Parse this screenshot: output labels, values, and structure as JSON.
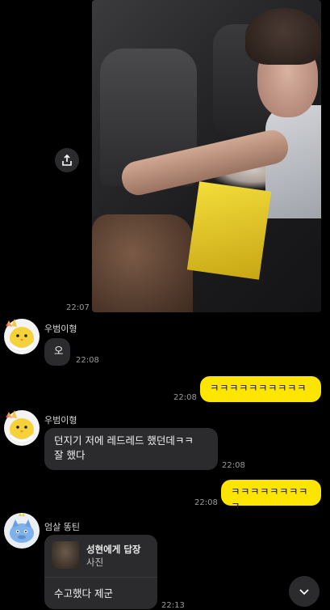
{
  "messages": {
    "photo_time": "22:07",
    "m1": {
      "sender": "우범이형",
      "text": "오",
      "time": "22:08"
    },
    "m2": {
      "text": "ㅋㅋㅋㅋㅋㅋㅋㅋㅋㅋ",
      "time": "22:08"
    },
    "m3": {
      "sender": "우범이형",
      "text_line1": "던지기 저에 레드레드 했던데ㅋㅋ",
      "text_line2": "잘 했다",
      "time": "22:08"
    },
    "m4": {
      "text": "ㅋㅋㅋㅋㅋㅋㅋㅋㅋ",
      "time": "22:08"
    },
    "m5": {
      "sender": "엄살 똥틴",
      "reply_to": "성현에게 답장",
      "reply_type": "사진",
      "text": "수고했다 제군",
      "time": "22:13"
    }
  },
  "colors": {
    "background": "#000000",
    "incoming_bubble": "#2b2b2d",
    "outgoing_bubble": "#fee500"
  },
  "icons": {
    "share": "share-icon",
    "scroll_down": "chevron-down-icon"
  }
}
